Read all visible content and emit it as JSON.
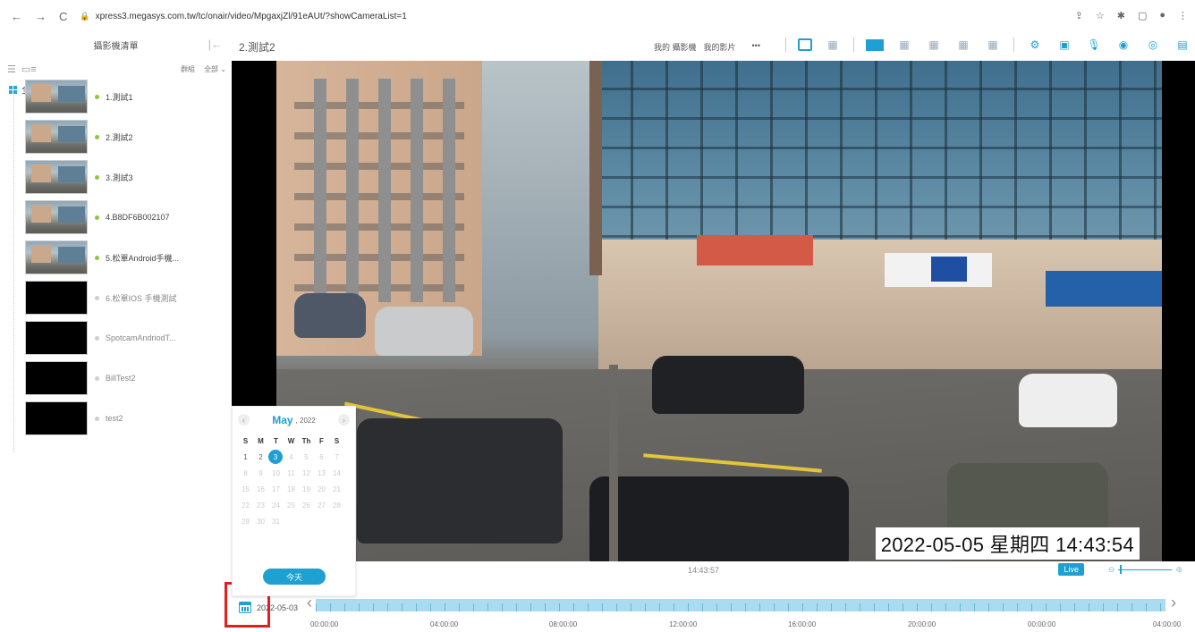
{
  "browser": {
    "url": "xpress3.megasys.com.tw/tc/onair/video/MpgaxjZl/91eAUt/?showCameraList=1"
  },
  "sidebar": {
    "title": "攝影機清單",
    "group_label": "群組",
    "all_dropdown": "全部",
    "tree_root": "全部",
    "cameras": [
      {
        "name": "1.測試1",
        "online": true,
        "thumb": "image"
      },
      {
        "name": "2.測試2",
        "online": true,
        "thumb": "image"
      },
      {
        "name": "3.測試3",
        "online": true,
        "thumb": "image"
      },
      {
        "name": "4.B8DF6B002107",
        "online": true,
        "thumb": "image"
      },
      {
        "name": "5.松單Android手機...",
        "online": true,
        "thumb": "image"
      },
      {
        "name": "6.松單IOS 手機測試",
        "online": false,
        "thumb": "black"
      },
      {
        "name": "SpotcamAndriodT...",
        "online": false,
        "thumb": "black"
      },
      {
        "name": "BillTest2",
        "online": false,
        "thumb": "black"
      },
      {
        "name": "test2",
        "online": false,
        "thumb": "black"
      }
    ]
  },
  "topbar": {
    "camera_title": "2.測試2",
    "my_cameras": "我的 攝影機",
    "my_videos": "我的影片",
    "more": "•••"
  },
  "video": {
    "timestamp": "2022-05-05  星期四  14:43:54"
  },
  "playback": {
    "current_time": "14:43:57",
    "live_label": "Live"
  },
  "timeline": {
    "date": "2022-05-03",
    "labels": [
      "00:00:00",
      "04:00:00",
      "08:00:00",
      "12:00:00",
      "16:00:00",
      "20:00:00",
      "00:00:00",
      "04:00:00"
    ]
  },
  "calendar": {
    "month": "May",
    "year": ", 2022",
    "weekdays": [
      "S",
      "M",
      "T",
      "W",
      "Th",
      "F",
      "S"
    ],
    "selected_day": 3,
    "today_button": "今天"
  },
  "colors": {
    "accent": "#1ea0d2",
    "online": "#8dc63f",
    "highlight": "#e02020"
  }
}
